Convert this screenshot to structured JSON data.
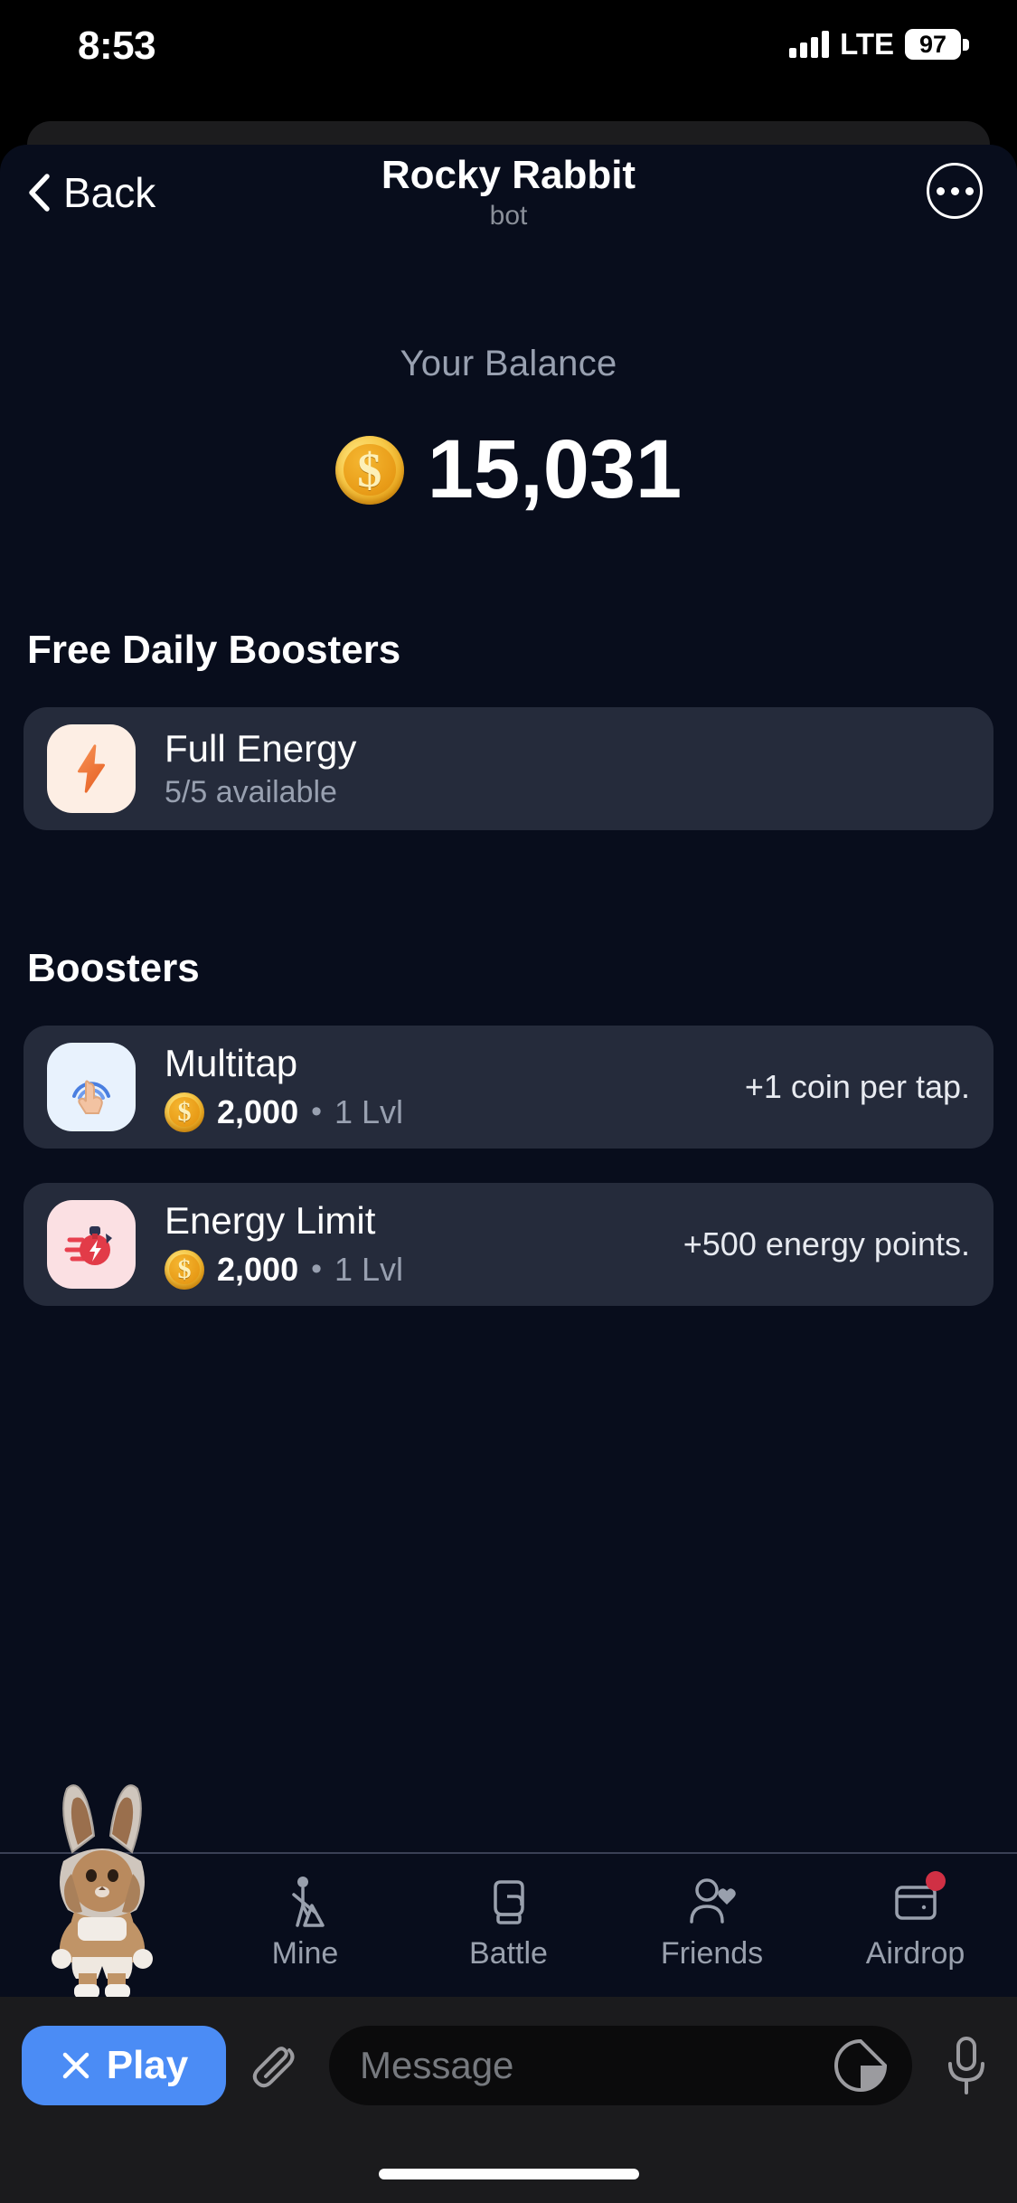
{
  "status_bar": {
    "time": "8:53",
    "network": "LTE",
    "battery": "97",
    "signal_icon": "signal-bars-icon",
    "battery_icon": "battery-icon"
  },
  "nav": {
    "back_label": "Back",
    "back_icon": "chevron-left-icon",
    "title": "Rocky Rabbit",
    "subtitle": "bot",
    "more_icon": "more-options-icon"
  },
  "balance": {
    "label": "Your Balance",
    "amount": "15,031",
    "coin_icon": "gold-coin-icon"
  },
  "free_daily": {
    "title": "Free Daily Boosters",
    "items": [
      {
        "name": "Full Energy",
        "sub": "5/5 available",
        "icon": "lightning-bolt-icon"
      }
    ]
  },
  "boosters": {
    "title": "Boosters",
    "items": [
      {
        "name": "Multitap",
        "cost": "2,000",
        "separator": "•",
        "level": "1 Lvl",
        "effect": "+1 coin per tap.",
        "icon": "tap-finger-icon",
        "coin_icon": "gold-coin-icon"
      },
      {
        "name": "Energy Limit",
        "cost": "2,000",
        "separator": "•",
        "level": "1 Lvl",
        "effect": "+500 energy points.",
        "icon": "energy-battery-icon",
        "coin_icon": "gold-coin-icon"
      }
    ]
  },
  "tabbar": {
    "hero_icon": "rabbit-character-avatar",
    "tabs": [
      {
        "label": "Mine",
        "icon": "pickaxe-miner-icon",
        "badge": false
      },
      {
        "label": "Battle",
        "icon": "boxing-glove-icon",
        "badge": false
      },
      {
        "label": "Friends",
        "icon": "person-heart-icon",
        "badge": false
      },
      {
        "label": "Airdrop",
        "icon": "airdrop-box-icon",
        "badge": true
      }
    ]
  },
  "composer": {
    "play_label": "Play",
    "play_close_icon": "close-x-icon",
    "attach_icon": "paperclip-icon",
    "message_placeholder": "Message",
    "sticker_icon": "sticker-icon",
    "mic_icon": "microphone-icon"
  },
  "colors": {
    "sheet_background": "#080d1c",
    "card_background": "#252b3b",
    "accent_blue": "#4b8cf5",
    "muted_text": "#98a0b0",
    "badge_red": "#d03044",
    "coin_gold": "#f2b01e"
  }
}
